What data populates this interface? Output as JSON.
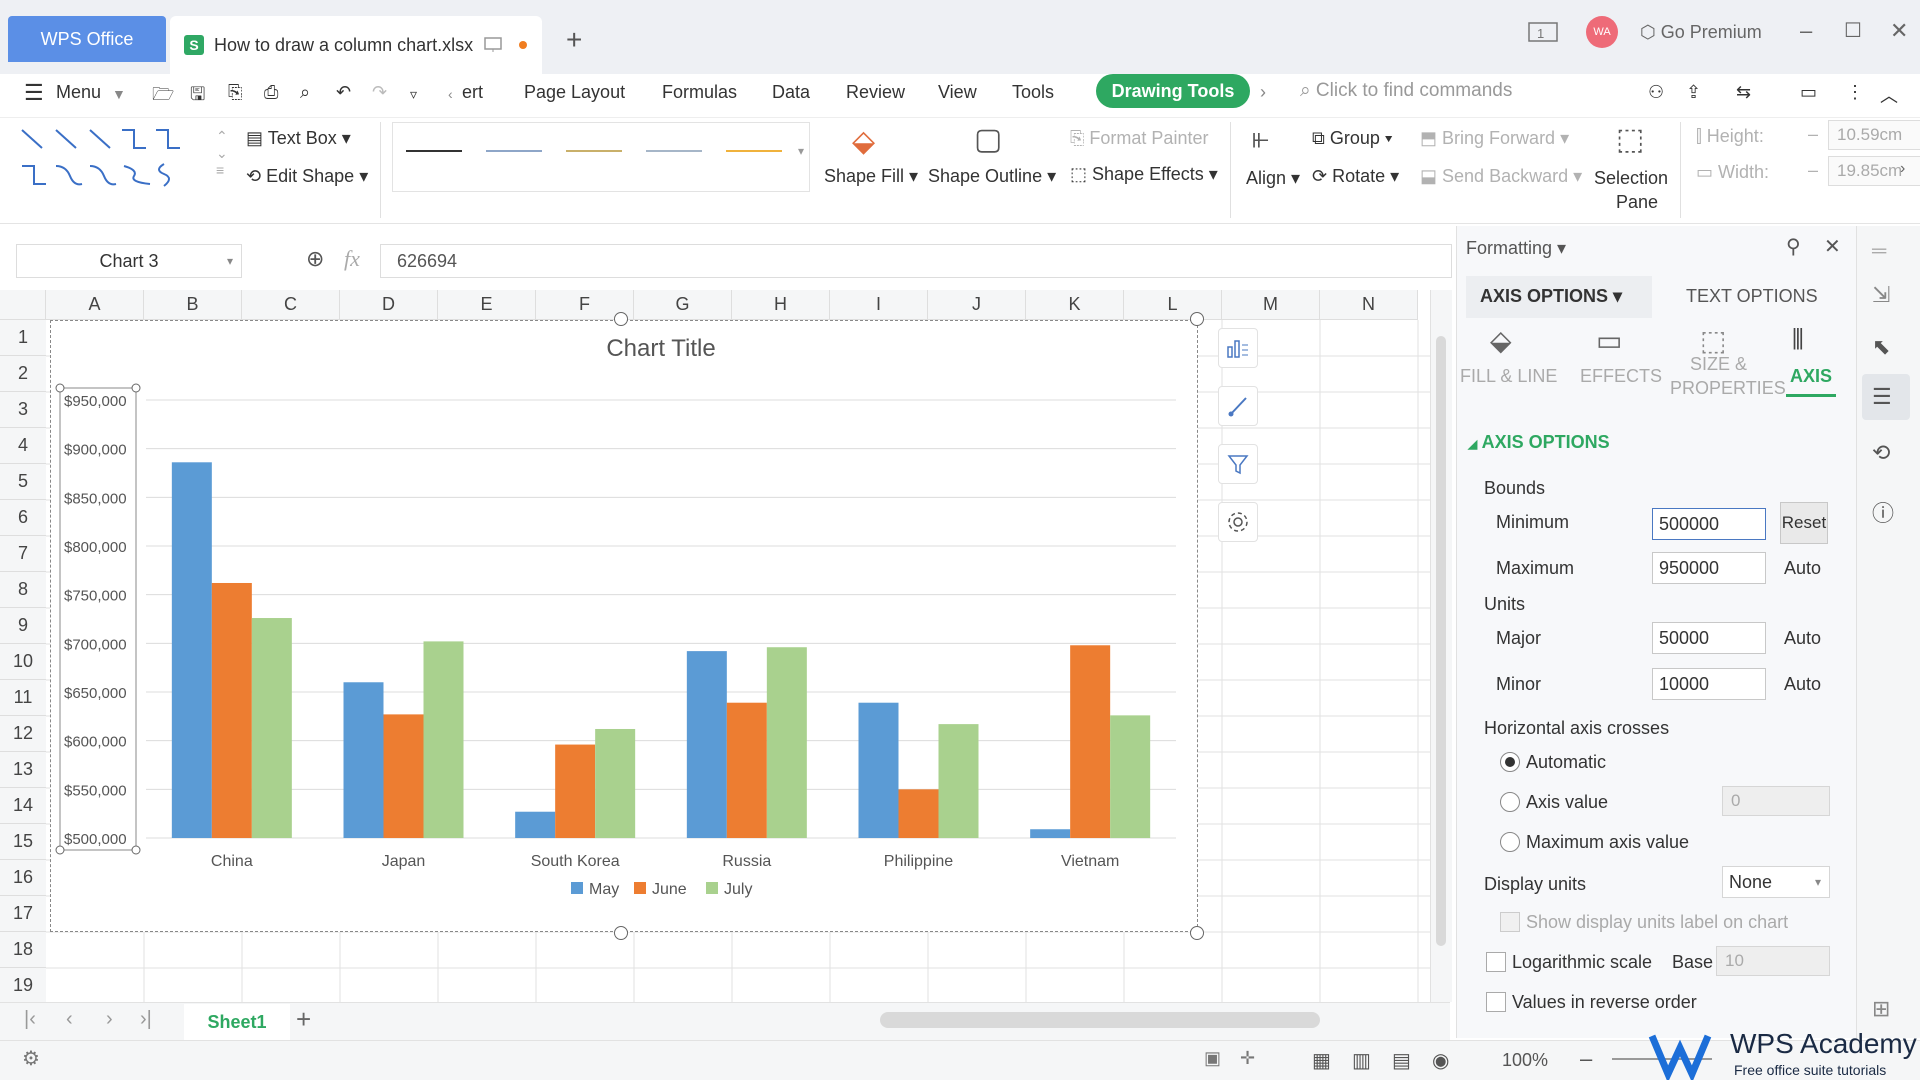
{
  "titlebar": {
    "app_tab": "WPS Office",
    "doc_tab": "How to draw a column chart.xlsx",
    "go_premium": "Go Premium",
    "avatar": "WA",
    "page_badge": "1"
  },
  "menu": {
    "menu_label": "Menu",
    "insert_cut": "ert",
    "items": [
      "Page Layout",
      "Formulas",
      "Data",
      "Review",
      "View",
      "Tools"
    ],
    "drawing_tools": "Drawing Tools",
    "search_placeholder": "Click to find commands"
  },
  "ribbon": {
    "text_box": "Text Box",
    "edit_shape": "Edit Shape",
    "shape_fill": "Shape Fill",
    "shape_outline": "Shape Outline",
    "format_painter": "Format Painter",
    "shape_effects": "Shape Effects",
    "align": "Align",
    "group": "Group",
    "rotate": "Rotate",
    "bring_forward": "Bring Forward",
    "send_backward": "Send Backward",
    "selection_pane_1": "Selection",
    "selection_pane_2": "Pane",
    "height_label": "Height:",
    "height_value": "10.59cm",
    "width_label": "Width:",
    "width_value": "19.85cm",
    "line_colors": [
      "#333333",
      "#8ea6c8",
      "#c9b06a",
      "#a6b6c8",
      "#f0b23c"
    ]
  },
  "formula_bar": {
    "name_box": "Chart 3",
    "fx": "fx",
    "value": "626694"
  },
  "sheet": {
    "columns": [
      "A",
      "B",
      "C",
      "D",
      "E",
      "F",
      "G",
      "H",
      "I",
      "J",
      "K",
      "L",
      "M",
      "N"
    ],
    "rows": [
      "1",
      "2",
      "3",
      "4",
      "5",
      "6",
      "7",
      "8",
      "9",
      "10",
      "11",
      "12",
      "13",
      "14",
      "15",
      "16",
      "17",
      "18",
      "19"
    ],
    "tab_name": "Sheet1",
    "zoom": "100%"
  },
  "chart_data": {
    "type": "bar",
    "title": "Chart Title",
    "categories": [
      "China",
      "Japan",
      "South Korea",
      "Russia",
      "Philippine",
      "Vietnam"
    ],
    "series": [
      {
        "name": "May",
        "color": "#5b9bd5",
        "values": [
          886000,
          660000,
          527000,
          692000,
          639000,
          509000
        ]
      },
      {
        "name": "June",
        "color": "#ed7d31",
        "values": [
          762000,
          627000,
          596000,
          639000,
          550000,
          698000
        ]
      },
      {
        "name": "July",
        "color": "#a9d18e",
        "values": [
          726000,
          702000,
          612000,
          696000,
          617000,
          626000
        ]
      }
    ],
    "ylim": [
      500000,
      950000
    ],
    "y_ticks": [
      "$500,000",
      "$550,000",
      "$600,000",
      "$650,000",
      "$700,000",
      "$750,000",
      "$800,000",
      "$850,000",
      "$900,000",
      "$950,000"
    ],
    "grid": true,
    "legend": "bottom"
  },
  "pane": {
    "header": "Formatting",
    "tab_axis_options": "AXIS OPTIONS",
    "tab_text_options": "TEXT OPTIONS",
    "sub_fill_line": "FILL & LINE",
    "sub_effects": "EFFECTS",
    "sub_size_1": "SIZE &",
    "sub_size_2": "PROPERTIES",
    "sub_axis": "AXIS",
    "section": "AXIS OPTIONS",
    "bounds": "Bounds",
    "minimum_label": "Minimum",
    "minimum_value": "500000",
    "reset": "Reset",
    "maximum_label": "Maximum",
    "maximum_value": "950000",
    "auto": "Auto",
    "units": "Units",
    "major_label": "Major",
    "major_value": "50000",
    "minor_label": "Minor",
    "minor_value": "10000",
    "h_axis_crosses": "Horizontal axis crosses",
    "automatic": "Automatic",
    "axis_value": "Axis value",
    "axis_value_input": "0",
    "max_axis_value": "Maximum axis value",
    "display_units": "Display units",
    "display_units_value": "None",
    "show_units_label": "Show display units label on chart",
    "log_scale": "Logarithmic scale",
    "base_label": "Base",
    "base_value": "10",
    "reverse_order": "Values in reverse order"
  },
  "watermark": {
    "brand": "WPS Academy",
    "tagline": "Free office suite tutorials"
  }
}
